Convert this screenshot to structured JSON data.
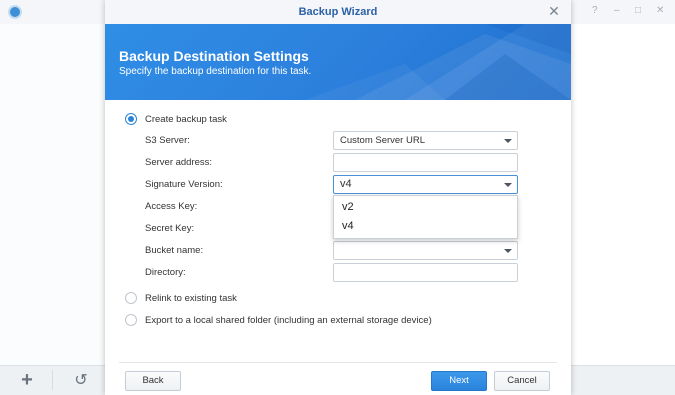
{
  "background_window": {
    "controls": [
      "?",
      "–",
      "□",
      "✕"
    ],
    "bottom_buttons": [
      {
        "icon": "plus-icon",
        "glyph": "+"
      },
      {
        "icon": "history-icon",
        "glyph": "↺"
      }
    ]
  },
  "dialog": {
    "title": "Backup Wizard",
    "close_glyph": "✕",
    "banner": {
      "title": "Backup Destination Settings",
      "subtitle": "Specify the backup destination for this task."
    },
    "options": {
      "create": "Create backup task",
      "relink": "Relink to existing task",
      "export": "Export to a local shared folder (including an external storage device)"
    },
    "fields": {
      "s3_server": {
        "label": "S3 Server:",
        "value": "Custom Server URL"
      },
      "server_address": {
        "label": "Server address:",
        "value": ""
      },
      "signature_version": {
        "label": "Signature Version:",
        "value": "v4"
      },
      "access_key": {
        "label": "Access Key:"
      },
      "secret_key": {
        "label": "Secret Key:"
      },
      "bucket_name": {
        "label": "Bucket name:",
        "value": ""
      },
      "directory": {
        "label": "Directory:",
        "value": ""
      }
    },
    "signature_options": [
      "v2",
      "v4"
    ],
    "buttons": {
      "back": "Back",
      "next": "Next",
      "cancel": "Cancel"
    }
  },
  "colors": {
    "accent": "#2b83d8",
    "title_text": "#2c61a6",
    "banner": "#2c7fdc"
  }
}
